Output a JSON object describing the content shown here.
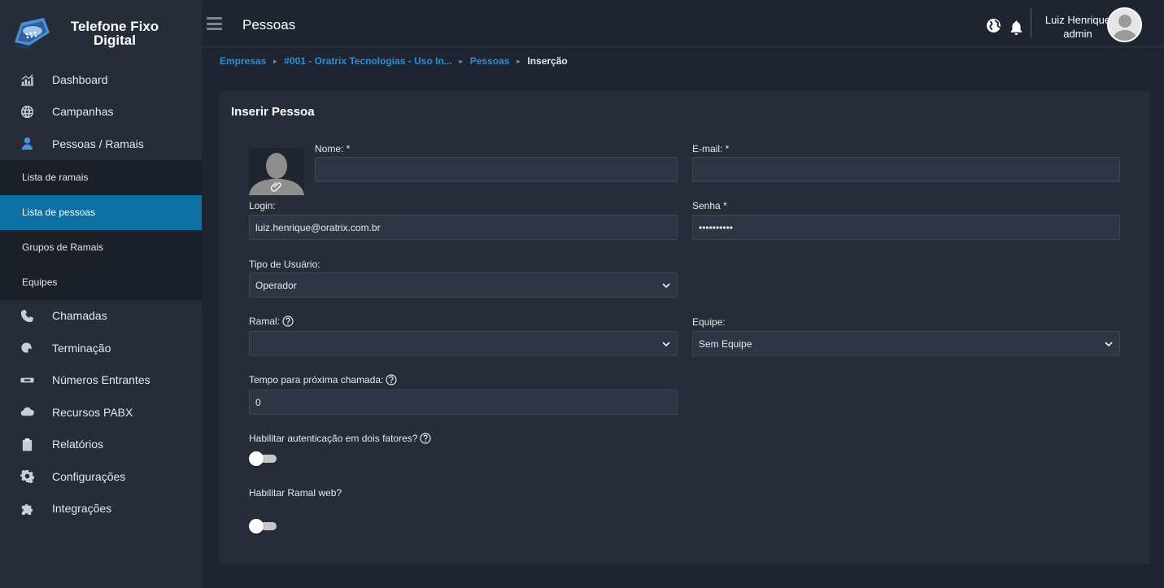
{
  "app": {
    "logo_line1": "Telefone Fixo",
    "logo_line2": "Digital"
  },
  "sidebar": {
    "items": [
      {
        "label": "Dashboard",
        "icon": "chart-icon"
      },
      {
        "label": "Campanhas",
        "icon": "globe-icon"
      },
      {
        "label": "Pessoas / Ramais",
        "icon": "person-icon"
      },
      {
        "label": "Chamadas",
        "icon": "phone-icon"
      },
      {
        "label": "Terminação",
        "icon": "globe-phone-icon"
      },
      {
        "label": "Números Entrantes",
        "icon": "sip-card-icon"
      },
      {
        "label": "Recursos PABX",
        "icon": "cloud-icon"
      },
      {
        "label": "Relatórios",
        "icon": "clipboard-icon"
      },
      {
        "label": "Configurações",
        "icon": "gear-icon"
      },
      {
        "label": "Integrações",
        "icon": "puzzle-icon"
      }
    ],
    "subitems": [
      {
        "label": "Lista de ramais"
      },
      {
        "label": "Lista de pessoas"
      },
      {
        "label": "Grupos de Ramais"
      },
      {
        "label": "Equipes"
      }
    ],
    "accent": "#0e6fa3"
  },
  "topbar": {
    "title": "Pessoas",
    "user_name": "Luiz Henrique",
    "user_role": "admin"
  },
  "breadcrumb": {
    "items": [
      "Empresas",
      "#001 - Oratrix Tecnologias - Uso In...",
      "Pessoas"
    ],
    "current": "Inserção",
    "link_color": "#2b8fd6"
  },
  "form": {
    "title": "Inserir Pessoa",
    "nome_label": "Nome: *",
    "nome_value": "",
    "email_label": "E-mail: *",
    "email_value": "",
    "login_label": "Login:",
    "login_value": "luiz.henrique@oratrix.com.br",
    "senha_label": "Senha *",
    "senha_value": "••••••••••",
    "tipo_label": "Tipo de Usuário:",
    "tipo_value": "Operador",
    "ramal_label": "Ramal:",
    "ramal_value": "",
    "equipe_label": "Equipe:",
    "equipe_value": "Sem Equipe",
    "tempo_label": "Tempo para próxima chamada:",
    "tempo_value": "0",
    "twofa_label": "Habilitar autenticação em dois fatores?",
    "twofa_enabled": false,
    "ramalweb_label": "Habilitar Ramal web?",
    "ramalweb_enabled": false
  }
}
